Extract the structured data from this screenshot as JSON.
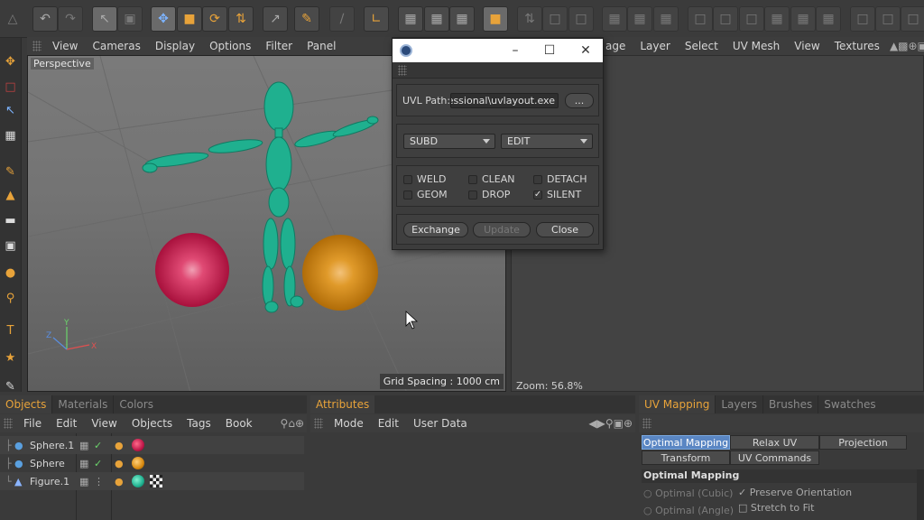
{
  "viewport": {
    "menu": [
      "View",
      "Cameras",
      "Display",
      "Options",
      "Filter",
      "Panel"
    ],
    "label": "Perspective",
    "grid_spacing": "Grid Spacing : 1000 cm"
  },
  "uv_view": {
    "menu": [
      "age",
      "Layer",
      "Select",
      "UV Mesh",
      "View",
      "Textures"
    ],
    "zoom": "Zoom: 56.8%"
  },
  "dialog": {
    "uvl_path_label": "UVL Path:",
    "uvl_path_value": "essional\\uvlayout.exe",
    "browse_label": "...",
    "subd_select": "SUBD",
    "mode_select": "EDIT",
    "checkboxes": [
      {
        "label": "WELD",
        "checked": false
      },
      {
        "label": "CLEAN",
        "checked": false
      },
      {
        "label": "DETACH",
        "checked": false
      },
      {
        "label": "GEOM",
        "checked": false
      },
      {
        "label": "DROP",
        "checked": false
      },
      {
        "label": "SILENT",
        "checked": true
      }
    ],
    "exchange_label": "Exchange",
    "update_label": "Update",
    "close_label": "Close",
    "win_min": "–",
    "win_max": "☐",
    "win_close": "✕"
  },
  "objects_panel": {
    "tabs": [
      "Objects",
      "Materials",
      "Colors"
    ],
    "menu": [
      "File",
      "Edit",
      "View",
      "Objects",
      "Tags",
      "Book"
    ],
    "rows": [
      {
        "name": "Sphere.1",
        "material_color": "#c0184a"
      },
      {
        "name": "Sphere",
        "material_color": "#d88a10"
      },
      {
        "name": "Figure.1",
        "material_color": "#1fb08f"
      }
    ]
  },
  "attributes_panel": {
    "tab": "Attributes",
    "menu": [
      "Mode",
      "Edit",
      "User Data"
    ]
  },
  "uv_panel": {
    "tabs": [
      "UV Mapping",
      "Layers",
      "Brushes",
      "Swatches"
    ],
    "buttons_row1": [
      "Optimal Mapping",
      "Relax UV",
      "Projection"
    ],
    "buttons_row2": [
      "Transform",
      "UV Commands"
    ],
    "section_title": "Optimal Mapping",
    "radio_cubic": "Optimal (Cubic)",
    "radio_angle": "Optimal (Angle)",
    "opt_preserve": "Preserve Orientation",
    "opt_stretch": "Stretch to Fit"
  },
  "colors": {
    "accent": "#e8a33a",
    "figure": "#1fb08f",
    "red_sphere": "#c0184a",
    "orange_sphere": "#d88a10",
    "selected_button": "#5a86c3"
  }
}
